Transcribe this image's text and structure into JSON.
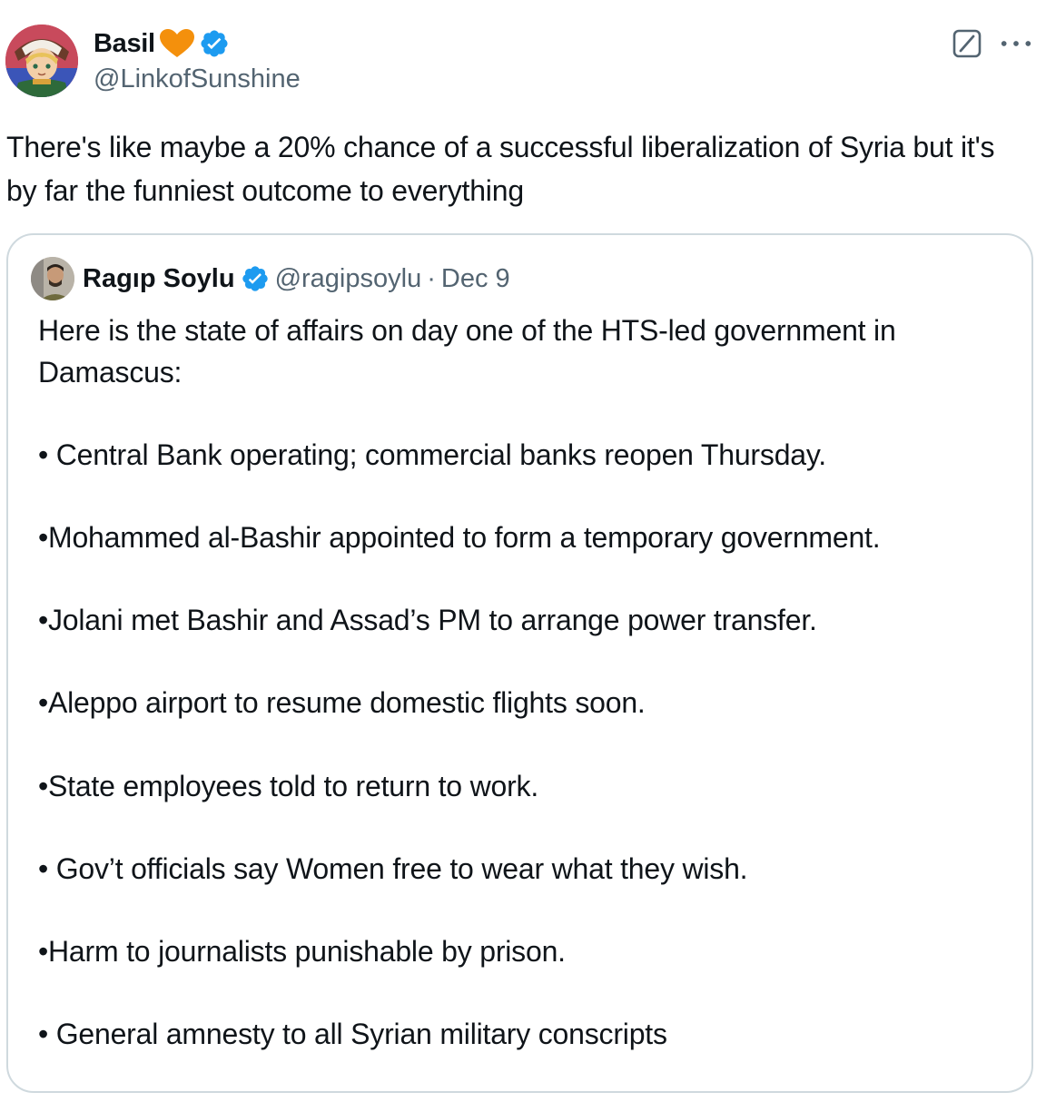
{
  "author": {
    "display_name": "Basil",
    "handle": "@LinkofSunshine"
  },
  "tweet": {
    "text": "There's like maybe a 20% chance of a successful liberalization of Syria but it's by far the funniest outcome to everything"
  },
  "quoted_tweet": {
    "display_name": "Ragıp Soylu",
    "handle": "@ragipsoylu",
    "separator": "·",
    "date": "Dec 9",
    "intro": "Here is the state of affairs on day one of the HTS-led government in Damascus:",
    "bullets": [
      "• Central Bank operating; commercial banks reopen Thursday.",
      "•Mohammed al-Bashir appointed to form a temporary government.",
      "•Jolani met Bashir and Assad’s PM to arrange power transfer.",
      "•Aleppo airport to resume domestic flights soon.",
      "•State employees told to return to work.",
      "• Gov’t officials say Women free to wear what they wish.",
      "•Harm to journalists punishable by prison.",
      "• General amnesty to all Syrian military conscripts"
    ]
  },
  "icons": {
    "heart": "orange-heart-icon",
    "verified": "verified-badge-icon",
    "grok": "grok-icon",
    "more": "more-options-icon"
  },
  "colors": {
    "text": "#0f1419",
    "secondary": "#536471",
    "verified": "#1d9bf0",
    "heart": "#f4900c",
    "border": "#cfd9de"
  }
}
